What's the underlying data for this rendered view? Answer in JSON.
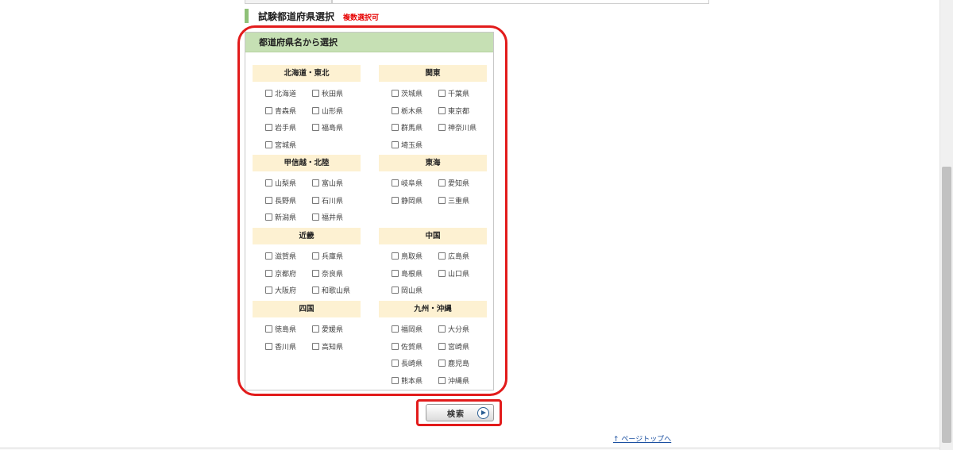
{
  "section": {
    "title": "試験都道府県選択",
    "note": "複数選択可"
  },
  "panel": {
    "header": "都道府県名から選択"
  },
  "regions": [
    {
      "name": "北海道・東北",
      "prefectures": [
        "北海道",
        "秋田県",
        "青森県",
        "山形県",
        "岩手県",
        "福島県",
        "宮城県"
      ]
    },
    {
      "name": "関東",
      "prefectures": [
        "茨城県",
        "千葉県",
        "栃木県",
        "東京都",
        "群馬県",
        "神奈川県",
        "埼玉県"
      ]
    },
    {
      "name": "甲信越・北陸",
      "prefectures": [
        "山梨県",
        "富山県",
        "長野県",
        "石川県",
        "新潟県",
        "福井県"
      ]
    },
    {
      "name": "東海",
      "prefectures": [
        "岐阜県",
        "愛知県",
        "静岡県",
        "三重県"
      ]
    },
    {
      "name": "近畿",
      "prefectures": [
        "滋賀県",
        "兵庫県",
        "京都府",
        "奈良県",
        "大阪府",
        "和歌山県"
      ]
    },
    {
      "name": "中国",
      "prefectures": [
        "鳥取県",
        "広島県",
        "島根県",
        "山口県",
        "岡山県"
      ]
    },
    {
      "name": "四国",
      "prefectures": [
        "徳島県",
        "愛媛県",
        "香川県",
        "高知県"
      ]
    },
    {
      "name": "九州・沖縄",
      "prefectures": [
        "福岡県",
        "大分県",
        "佐賀県",
        "宮崎県",
        "長崎県",
        "鹿児島",
        "熊本県",
        "沖縄県"
      ]
    }
  ],
  "search_button": {
    "label": "検索",
    "icon": "play-circle-icon"
  },
  "page_top_link": "↑ ページトップへ",
  "colors": {
    "accent_green": "#8fc178",
    "panel_header_bg": "#c6e0b4",
    "region_head_bg": "#fdf1d2",
    "note_red": "#e60000",
    "highlight_red": "#e21b1b",
    "link_blue": "#1a4fa0"
  }
}
